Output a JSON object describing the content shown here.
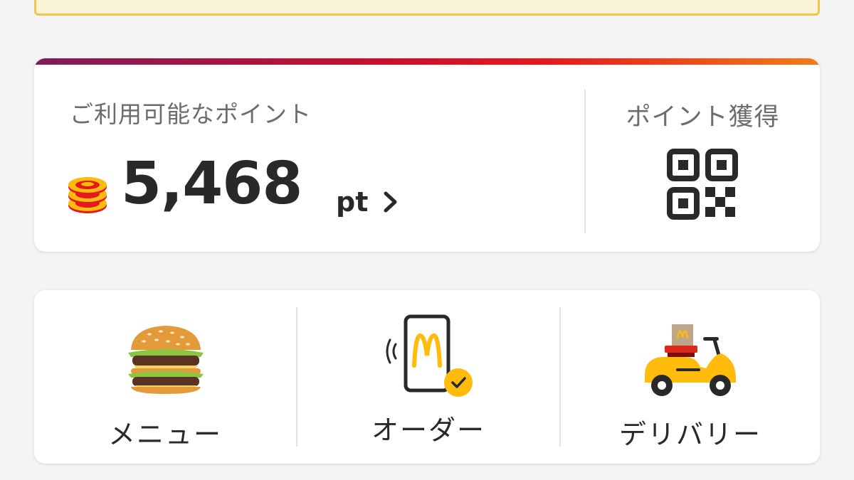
{
  "points": {
    "label": "ご利用可能なポイント",
    "value": "5,468",
    "unit": "pt",
    "coin_icon": "coin-stack-icon",
    "chevron_icon": "chevron-right-icon"
  },
  "earn": {
    "label": "ポイント獲得",
    "icon": "qr-code-icon"
  },
  "nav": {
    "items": [
      {
        "label": "メニュー",
        "icon": "burger-icon"
      },
      {
        "label": "オーダー",
        "icon": "mobile-order-icon"
      },
      {
        "label": "デリバリー",
        "icon": "delivery-scooter-icon"
      }
    ]
  },
  "colors": {
    "brand_yellow": "#ffbc0d",
    "brand_red": "#da291c",
    "banner_bg": "#fbf3d8",
    "banner_border": "#f2c64a",
    "text_primary": "#292929",
    "text_secondary": "#6c6c6c"
  }
}
